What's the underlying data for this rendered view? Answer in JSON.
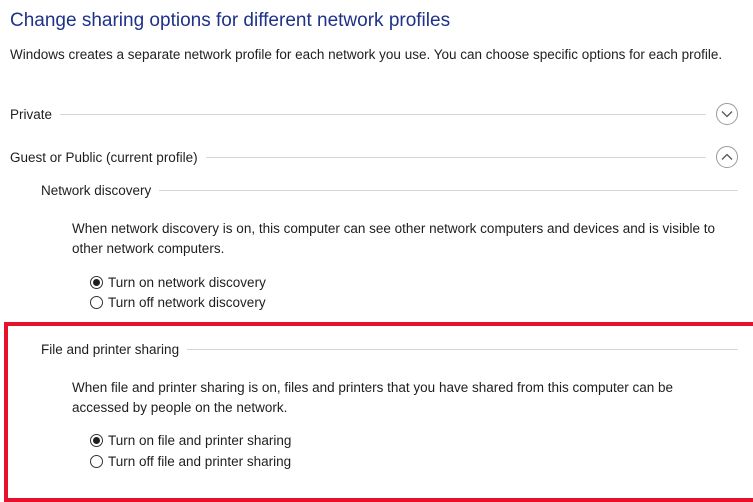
{
  "page": {
    "title": "Change sharing options for different network profiles",
    "description": "Windows creates a separate network profile for each network you use. You can choose specific options for each profile."
  },
  "profiles": {
    "private": {
      "label": "Private",
      "state": "collapsed"
    },
    "guest_public": {
      "label": "Guest or Public (current profile)",
      "state": "expanded",
      "network_discovery": {
        "heading": "Network discovery",
        "description": "When network discovery is on, this computer can see other network computers and devices and is visible to other network computers.",
        "option_on": "Turn on network discovery",
        "option_off": "Turn off network discovery",
        "selected": "on"
      },
      "file_printer_sharing": {
        "heading": "File and printer sharing",
        "description": "When file and printer sharing is on, files and printers that you have shared from this computer can be accessed by people on the network.",
        "option_on": "Turn on file and printer sharing",
        "option_off": "Turn off file and printer sharing",
        "selected": "on"
      }
    }
  },
  "icons": {
    "expand": "chevron-down-icon",
    "collapse": "chevron-up-icon"
  },
  "colors": {
    "title": "#1e3287",
    "highlight_border": "#e8112d",
    "rule": "#d6d6d6"
  }
}
